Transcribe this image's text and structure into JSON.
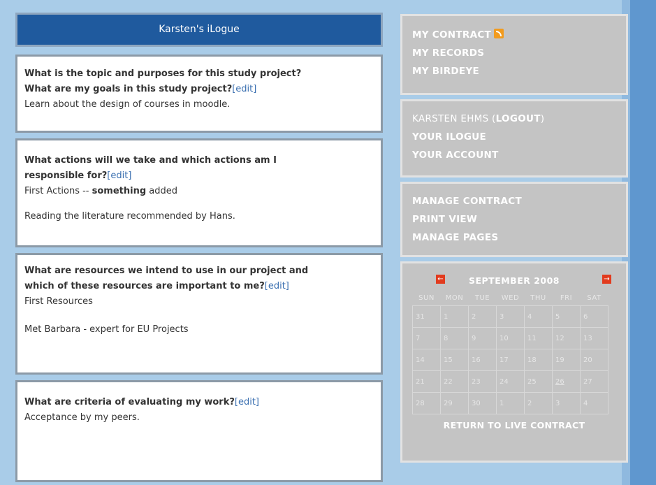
{
  "title": "Karsten's iLogue",
  "cards": [
    {
      "q1": "What is the topic and purposes for this study project?",
      "q2": "What are my goals in this study project?",
      "edit": "[edit]",
      "answer": "Learn about the design of courses in moodle."
    },
    {
      "q1": "What actions will we take and which actions am I",
      "q2": "responsible for?",
      "edit": "[edit]",
      "answer_prefix": "First Actions -- ",
      "answer_bold": "something",
      "answer_suffix": " added",
      "answer2": "Reading the literature recommended by Hans."
    },
    {
      "q1": "What are resources we intend to use in our project and",
      "q2": "which of these resources are important to me?",
      "edit": "[edit]",
      "answer": "First Resources",
      "answer2": "Met Barbara - expert for EU Projects"
    },
    {
      "q1": "What are criteria of evaluating my work?",
      "edit": "[edit]",
      "answer": "Acceptance by my peers."
    }
  ],
  "nav1": {
    "my_contract": "MY CONTRACT",
    "my_records": "MY RECORDS",
    "my_birdeye": "MY BIRDEYE",
    "rss_icon": "rss-icon"
  },
  "nav2": {
    "user": "KARSTEN EHMS",
    "logout": "LOGOUT",
    "your_ilogue": "YOUR ILOGUE",
    "your_account": "YOUR ACCOUNT"
  },
  "nav3": {
    "manage_contract": "MANAGE CONTRACT",
    "print_view": "PRINT VIEW",
    "manage_pages": "MANAGE PAGES"
  },
  "calendar": {
    "month": "SEPTEMBER 2008",
    "prev_icon": "arrow-left-icon",
    "next_icon": "arrow-right-icon",
    "weekdays": [
      "SUN",
      "MON",
      "TUE",
      "WED",
      "THU",
      "FRI",
      "SAT"
    ],
    "weeks": [
      [
        "31",
        "1",
        "2",
        "3",
        "4",
        "5",
        "6"
      ],
      [
        "7",
        "8",
        "9",
        "10",
        "11",
        "12",
        "13"
      ],
      [
        "14",
        "15",
        "16",
        "17",
        "18",
        "19",
        "20"
      ],
      [
        "21",
        "22",
        "23",
        "24",
        "25",
        "26",
        "27"
      ],
      [
        "28",
        "29",
        "30",
        "1",
        "2",
        "3",
        "4"
      ]
    ],
    "underlined_day": "26",
    "return": "RETURN TO LIVE CONTRACT"
  },
  "colors": {
    "title_bg": "#1f5a9e",
    "panel_bg": "#c4c4c4",
    "page_bg": "#a9cce8",
    "link": "#3a6fb0",
    "arrow": "#e23b1e"
  }
}
